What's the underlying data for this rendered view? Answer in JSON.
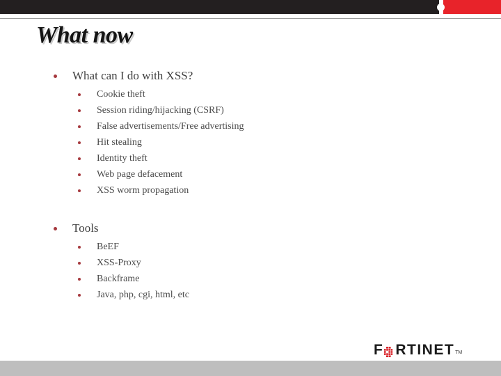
{
  "slide": {
    "title": "What now",
    "top_banner": {
      "dark_color": "#231f20",
      "accent_color": "#e8232a"
    },
    "footer_bar_color": "#bebebe",
    "bullet_color": "#a5383d",
    "text_color": "#3f3f3f"
  },
  "content": {
    "groups": [
      {
        "heading": "What can I do with XSS?",
        "items": [
          "Cookie theft",
          "Session riding/hijacking (CSRF)",
          "False advertisements/Free advertising",
          "Hit stealing",
          "Identity theft",
          "Web page defacement",
          "XSS worm propagation"
        ]
      },
      {
        "heading": "Tools",
        "items": [
          "BeEF",
          "XSS-Proxy",
          "Backframe",
          "Java, php, cgi, html, etc"
        ]
      }
    ]
  },
  "logo": {
    "part1": "F",
    "part2": "RTINET",
    "trademark": "TM",
    "dot_color": "#d8232a"
  }
}
